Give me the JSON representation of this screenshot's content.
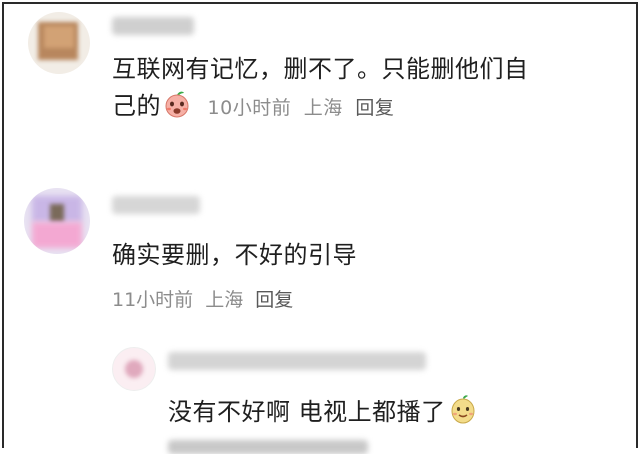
{
  "comments": [
    {
      "text_line1": "互联网有记忆，删不了。只能删他们自",
      "text_line2": "己的",
      "emoji": "peach-face-emoji",
      "time": "10小时前",
      "location": "上海",
      "reply": "回复"
    },
    {
      "text": "确实要删，不好的引导",
      "time": "11小时前",
      "location": "上海",
      "reply": "回复"
    }
  ],
  "sub_reply": {
    "text": "没有不好啊 电视上都播了",
    "emoji": "pear-face-emoji"
  },
  "colors": {
    "text": "#1f1f1f",
    "meta": "#8c8c8c",
    "border": "#2a2a2a"
  }
}
